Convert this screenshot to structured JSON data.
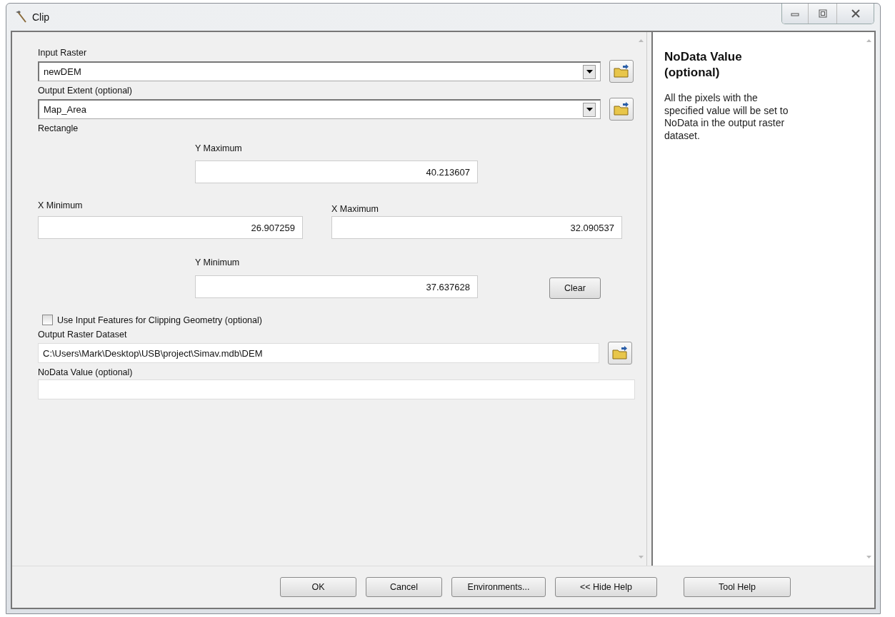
{
  "window": {
    "title": "Clip"
  },
  "input_raster": {
    "label": "Input Raster",
    "value": "newDEM"
  },
  "output_extent": {
    "label": "Output Extent (optional)",
    "value": "Map_Area"
  },
  "rectangle": {
    "label": "Rectangle",
    "y_maximum": {
      "label": "Y Maximum",
      "value": "40.213607"
    },
    "x_minimum": {
      "label": "X Minimum",
      "value": "26.907259"
    },
    "x_maximum": {
      "label": "X Maximum",
      "value": "32.090537"
    },
    "y_minimum": {
      "label": "Y Minimum",
      "value": "37.637628"
    },
    "clear_button": "Clear"
  },
  "use_input_features": {
    "label": "Use Input Features for Clipping Geometry (optional)",
    "checked": false
  },
  "output_raster": {
    "label": "Output Raster Dataset",
    "value": "C:\\Users\\Mark\\Desktop\\USB\\project\\Simav.mdb\\DEM"
  },
  "nodata": {
    "label": "NoData Value (optional)"
  },
  "help": {
    "title": "NoData Value (optional)",
    "body": "All the pixels with the specified value will be set to NoData in the output raster dataset."
  },
  "buttons": [
    "OK",
    "Cancel",
    "Environments...",
    "<< Hide Help",
    "Tool Help"
  ]
}
